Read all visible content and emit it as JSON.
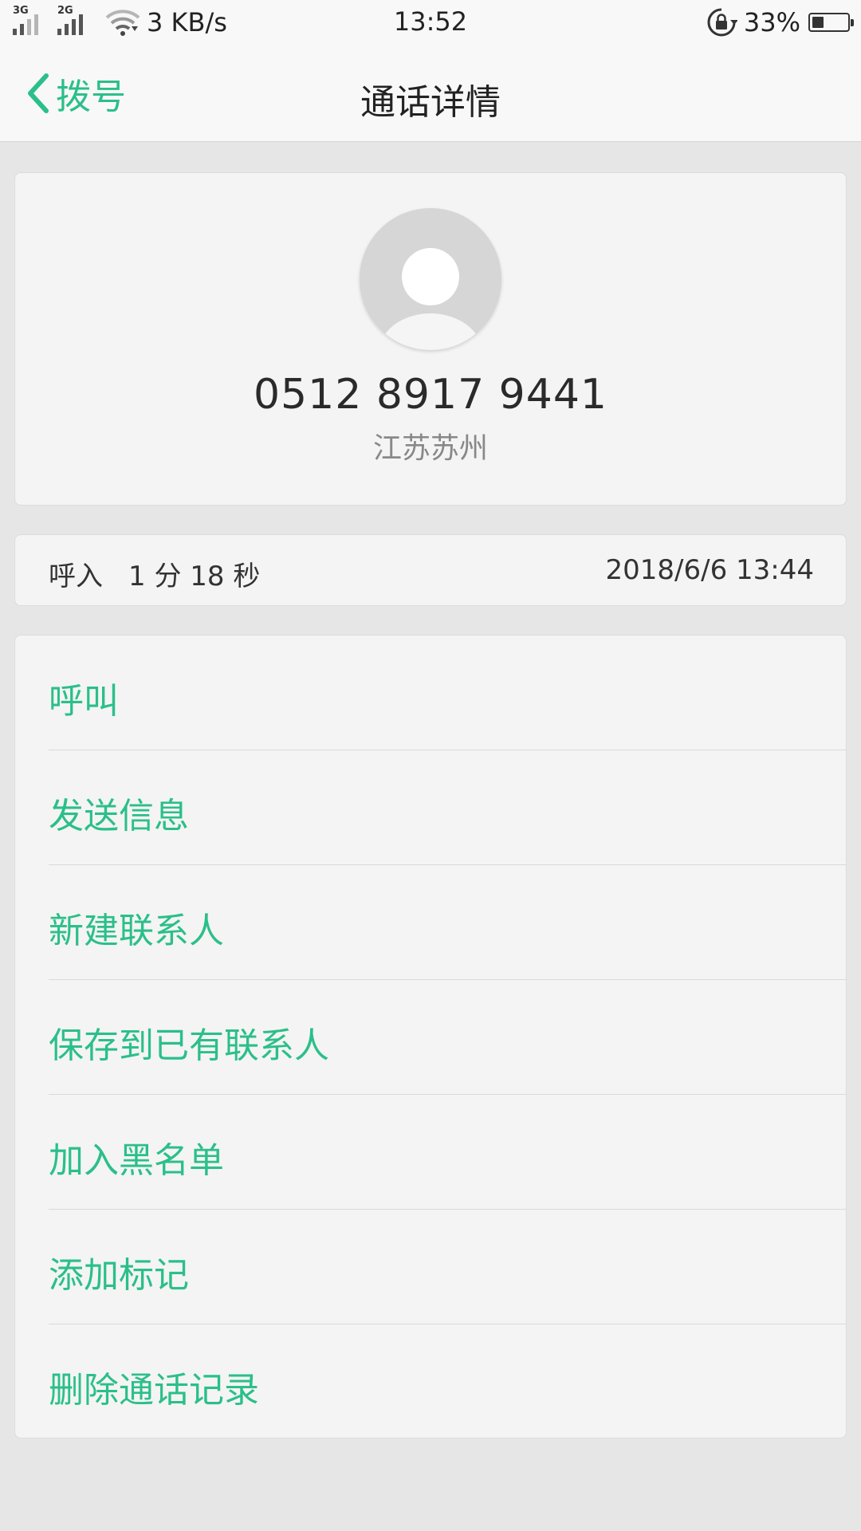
{
  "status_bar": {
    "network_1": "3G",
    "network_2": "2G",
    "speed": "3 KB/s",
    "time": "13:52",
    "battery_percent": "33%",
    "battery_level": 0.33,
    "icons": [
      "signal-3g-icon",
      "signal-2g-icon",
      "wifi-icon",
      "rotation-lock-icon",
      "battery-icon"
    ]
  },
  "nav": {
    "back_label": "拨号",
    "title": "通话详情"
  },
  "profile": {
    "phone_number": "0512 8917 9441",
    "location": "江苏苏州"
  },
  "call_record": {
    "type": "呼入",
    "duration": "1 分 18 秒",
    "datetime": "2018/6/6 13:44"
  },
  "actions": [
    {
      "label": "呼叫"
    },
    {
      "label": "发送信息"
    },
    {
      "label": "新建联系人"
    },
    {
      "label": "保存到已有联系人"
    },
    {
      "label": "加入黑名单"
    },
    {
      "label": "添加标记"
    },
    {
      "label": "删除通话记录"
    }
  ],
  "colors": {
    "accent": "#2bbf8a",
    "background": "#e6e6e6",
    "card": "#f4f4f4"
  }
}
